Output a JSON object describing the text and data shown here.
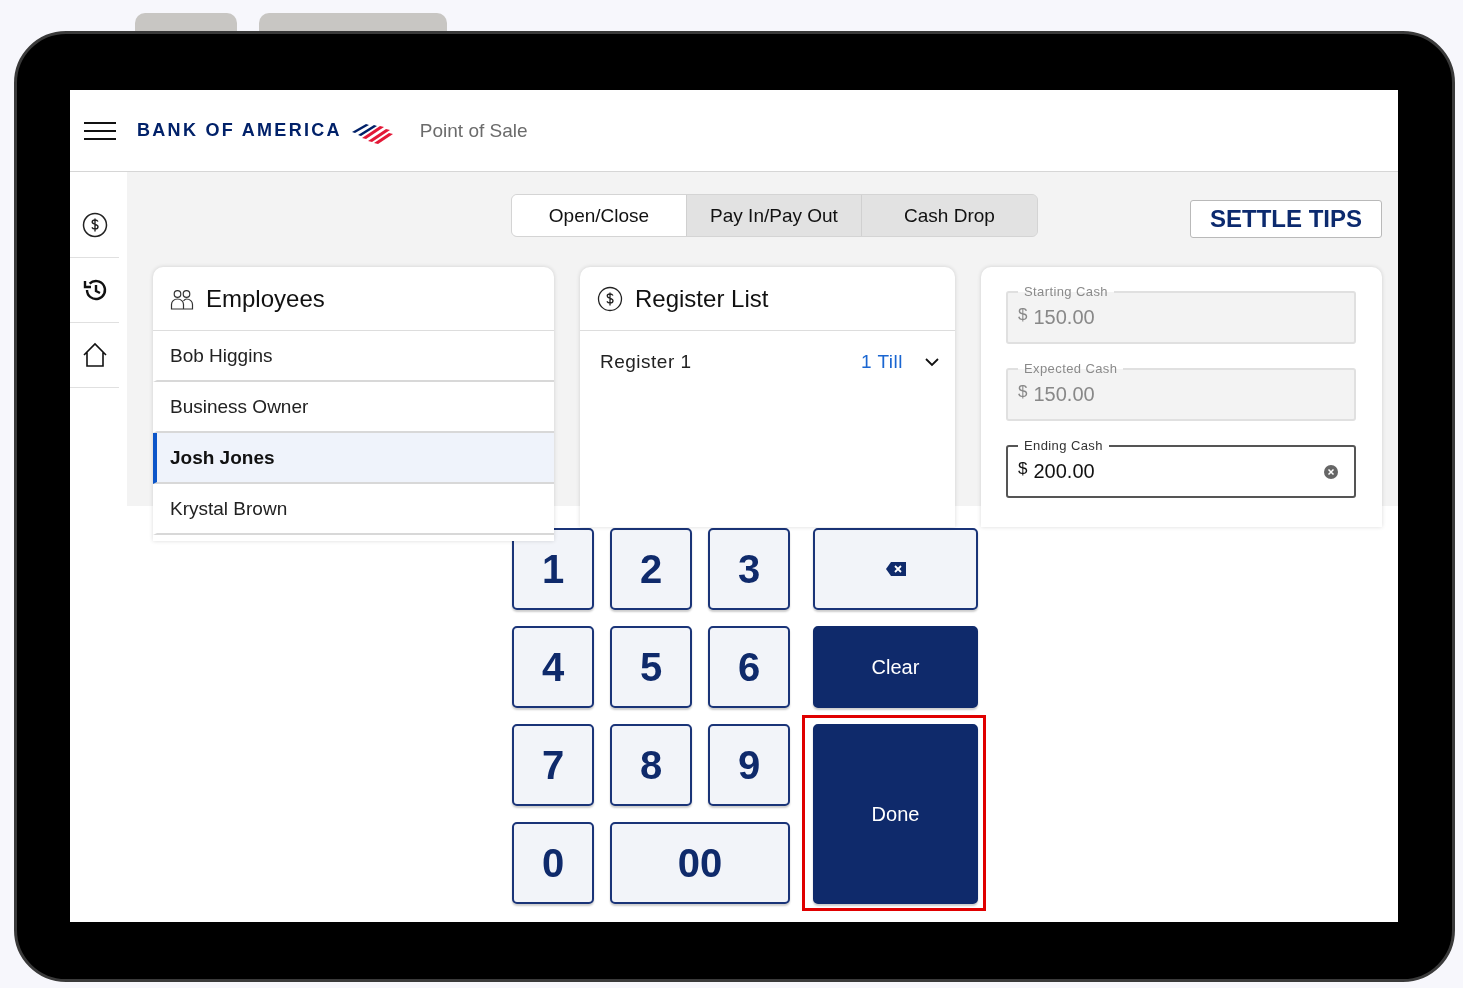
{
  "header": {
    "brand": "BANK OF AMERICA",
    "app_title": "Point of Sale"
  },
  "tabs": [
    {
      "label": "Open/Close",
      "selected": true
    },
    {
      "label": "Pay In/Pay Out",
      "selected": false
    },
    {
      "label": "Cash Drop",
      "selected": false
    }
  ],
  "settle_button": "SETTLE TIPS",
  "employees": {
    "title": "Employees",
    "items": [
      {
        "name": "Bob Higgins",
        "selected": false
      },
      {
        "name": "Business Owner",
        "selected": false
      },
      {
        "name": "Josh Jones",
        "selected": true
      },
      {
        "name": "Krystal Brown",
        "selected": false
      }
    ]
  },
  "register_list": {
    "title": "Register List",
    "items": [
      {
        "name": "Register 1",
        "tills": "1 Till",
        "expanded": false
      }
    ]
  },
  "cash_fields": [
    {
      "label": "Starting Cash",
      "currency": "$",
      "value": "150.00",
      "disabled": true
    },
    {
      "label": "Expected Cash",
      "currency": "$",
      "value": "150.00",
      "disabled": true
    },
    {
      "label": "Ending Cash",
      "currency": "$",
      "value": "200.00",
      "disabled": false
    }
  ],
  "keypad": [
    {
      "kind": "digit",
      "label": "1"
    },
    {
      "kind": "digit",
      "label": "2"
    },
    {
      "kind": "digit",
      "label": "3"
    },
    {
      "kind": "backspace"
    },
    {
      "kind": "digit",
      "label": "4"
    },
    {
      "kind": "digit",
      "label": "5"
    },
    {
      "kind": "digit",
      "label": "6"
    },
    {
      "kind": "clear",
      "label": "Clear"
    },
    {
      "kind": "digit",
      "label": "7"
    },
    {
      "kind": "digit",
      "label": "8"
    },
    {
      "kind": "digit",
      "label": "9"
    },
    {
      "kind": "done",
      "label": "Done",
      "highlighted": true
    },
    {
      "kind": "digit",
      "label": "0"
    },
    {
      "kind": "wide",
      "label": "00"
    }
  ]
}
